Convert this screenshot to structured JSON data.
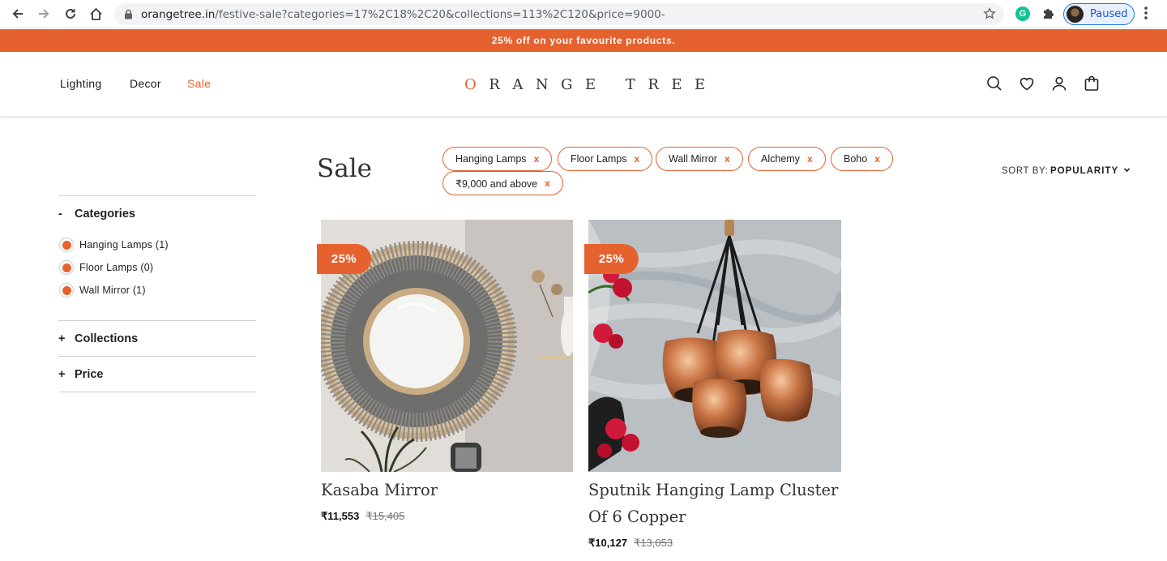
{
  "browser": {
    "url_host": "orangetree.in",
    "url_path": "/festive-sale?categories=17%2C18%2C20&collections=113%2C120&price=9000-",
    "profile_label": "Paused",
    "extension_letter": "G"
  },
  "announcement": "25% off on your favourite products.",
  "header": {
    "menu": [
      "Lighting",
      "Decor",
      "Sale"
    ],
    "logo_first": "O",
    "logo_rest": "RANGE TREE"
  },
  "sidebar": {
    "categories": {
      "sign": "-",
      "title": "Categories",
      "options": [
        "Hanging Lamps (1)",
        "Floor Lamps (0)",
        "Wall Mirror (1)"
      ]
    },
    "collections": {
      "sign": "+",
      "title": "Collections"
    },
    "price": {
      "sign": "+",
      "title": "Price"
    }
  },
  "main": {
    "title": "Sale",
    "chips": [
      "Hanging Lamps",
      "Floor Lamps",
      "Wall Mirror",
      "Alchemy",
      "Boho",
      "₹9,000 and above"
    ],
    "chip_remove": "x",
    "sort_label": "SORT BY:",
    "sort_value": "POPULARITY"
  },
  "products": [
    {
      "badge": "25%",
      "name": "Kasaba Mirror",
      "price": "₹11,553",
      "old_price": "₹15,405"
    },
    {
      "badge": "25%",
      "name": "Sputnik Hanging Lamp Cluster Of 6 Copper",
      "price": "₹10,127",
      "old_price": "₹13,053"
    }
  ],
  "colors": {
    "accent": "#e5622f"
  }
}
